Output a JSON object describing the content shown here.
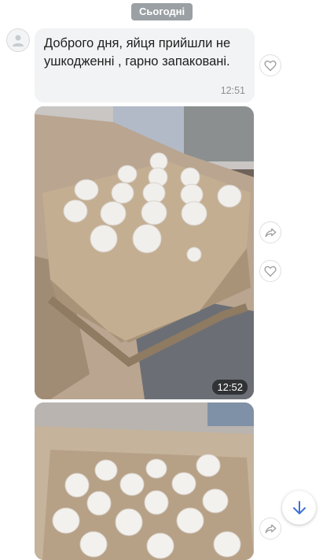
{
  "chat": {
    "date_separator": "Сьогодні",
    "message": {
      "text": "Доброго дня, яйця прийшли не ушкодженні , гарно запаковані.",
      "time": "12:51"
    },
    "photos": [
      {
        "time": "12:52"
      },
      {
        "time": ""
      }
    ]
  },
  "icons": {
    "avatar": "user-avatar-icon",
    "like": "heart-icon",
    "share": "share-icon",
    "scroll_down": "arrow-down-icon"
  },
  "colors": {
    "accent": "#3f6fd6",
    "bubble": "#f2f3f4",
    "date_pill": "#9aa0a3"
  }
}
